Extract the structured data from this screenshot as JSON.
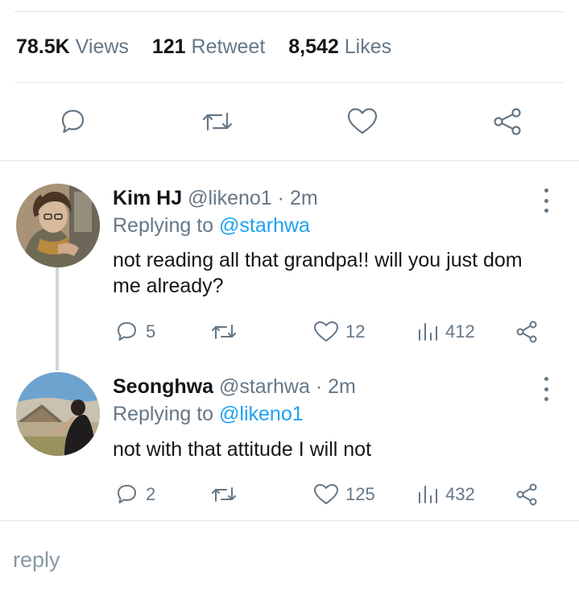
{
  "stats": {
    "views_count": "78.5K",
    "views_label": "Views",
    "retweet_count": "121",
    "retweet_label": "Retweet",
    "likes_count": "8,542",
    "likes_label": "Likes"
  },
  "actions": [
    "reply-icon",
    "retweet-icon",
    "like-icon",
    "share-icon"
  ],
  "replies": [
    {
      "name": "Kim HJ",
      "handle": "@likeno1",
      "separator": "·",
      "time": "2m",
      "replying_prefix": "Replying to",
      "replying_to": "@starhwa",
      "text": "not reading all that grandpa!! will you just dom me already?",
      "reply_count": "5",
      "like_count": "12",
      "views": "412"
    },
    {
      "name": "Seonghwa",
      "handle": "@starhwa",
      "separator": "·",
      "time": "2m",
      "replying_prefix": "Replying to",
      "replying_to": "@likeno1",
      "text": "not with that attitude I will not",
      "reply_count": "2",
      "like_count": "125",
      "views": "432"
    }
  ],
  "composer": {
    "placeholder": "reply"
  },
  "colors": {
    "accent": "#1da1f2",
    "muted": "#657786",
    "divider": "#e1e8ed"
  }
}
